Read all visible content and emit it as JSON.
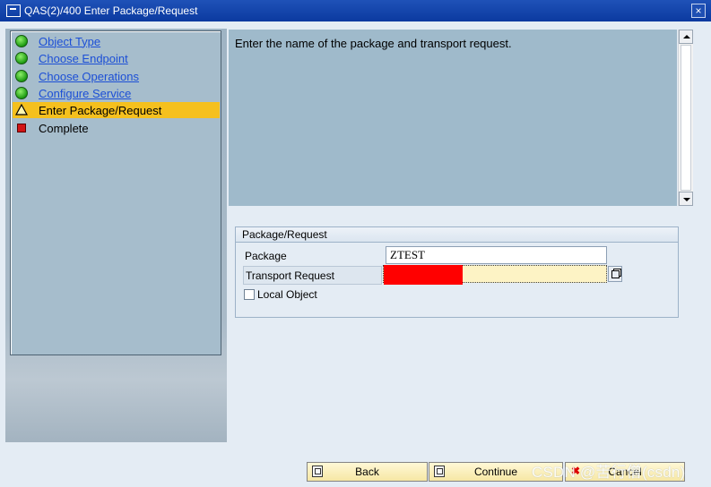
{
  "window": {
    "title": "QAS(2)/400 Enter Package/Request",
    "close_symbol": "×"
  },
  "steps": [
    {
      "label": "Object Type",
      "status": "done",
      "icon": "green-light-icon"
    },
    {
      "label": "Choose Endpoint",
      "status": "done",
      "icon": "green-light-icon"
    },
    {
      "label": "Choose Operations",
      "status": "done",
      "icon": "green-light-icon"
    },
    {
      "label": "Configure Service",
      "status": "done",
      "icon": "green-light-icon"
    },
    {
      "label": "Enter Package/Request",
      "status": "active",
      "icon": "warning-triangle-icon"
    },
    {
      "label": "Complete",
      "status": "pending",
      "icon": "red-square-icon"
    }
  ],
  "description": "Enter the name of the package and transport request.",
  "group": {
    "title": "Package/Request",
    "package_label": "Package",
    "package_value": "ZTEST",
    "transport_label": "Transport Request",
    "transport_value": "",
    "local_object_label": "Local Object"
  },
  "buttons": {
    "back": "Back",
    "continue": "Continue",
    "cancel": "Cancel",
    "cancel_icon": "✖"
  },
  "watermark": "CSDN @苦行僧(csdn)",
  "colors": {
    "active_step": "#f5c01e",
    "link": "#1c4fd6",
    "redaction": "#ff0000"
  }
}
